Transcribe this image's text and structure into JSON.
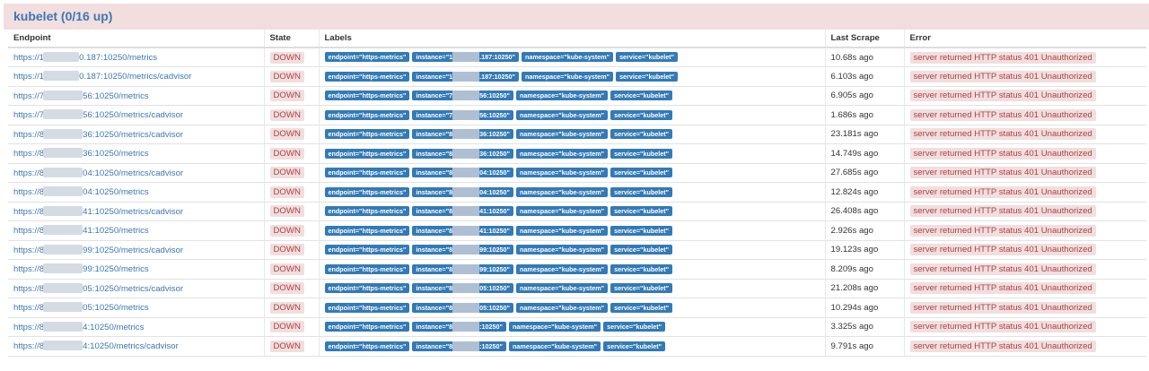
{
  "header": {
    "title": "kubelet (0/16 up)"
  },
  "columns": {
    "endpoint": "Endpoint",
    "state": "State",
    "labels": "Labels",
    "last_scrape": "Last Scrape",
    "error": "Error"
  },
  "colors": {
    "link": "#3b77b5",
    "header_bg": "#f2dede",
    "label_bg": "#337ab7",
    "error_text": "#a94442",
    "error_bg": "#f2dede"
  },
  "rows": [
    {
      "ep_prefix": "https://1",
      "ep_suffix": "0.187:10250/metrics",
      "state": "DOWN",
      "labels": [
        "endpoint=\"https-metrics\"",
        "instance=\"1",
        ".187:10250\"",
        "namespace=\"kube-system\"",
        "service=\"kubelet\""
      ],
      "last_scrape": "10.68s ago",
      "error": "server returned HTTP status 401 Unauthorized"
    },
    {
      "ep_prefix": "https://1",
      "ep_suffix": "0.187:10250/metrics/cadvisor",
      "state": "DOWN",
      "labels": [
        "endpoint=\"https-metrics\"",
        "instance=\"1",
        ".187:10250\"",
        "namespace=\"kube-system\"",
        "service=\"kubelet\""
      ],
      "last_scrape": "6.103s ago",
      "error": "server returned HTTP status 401 Unauthorized"
    },
    {
      "ep_prefix": "https://7",
      "ep_suffix": "56:10250/metrics",
      "state": "DOWN",
      "labels": [
        "endpoint=\"https-metrics\"",
        "instance=\"7",
        "56:10250\"",
        "namespace=\"kube-system\"",
        "service=\"kubelet\""
      ],
      "last_scrape": "6.905s ago",
      "error": "server returned HTTP status 401 Unauthorized"
    },
    {
      "ep_prefix": "https://7",
      "ep_suffix": "56:10250/metrics/cadvisor",
      "state": "DOWN",
      "labels": [
        "endpoint=\"https-metrics\"",
        "instance=\"7",
        "56:10250\"",
        "namespace=\"kube-system\"",
        "service=\"kubelet\""
      ],
      "last_scrape": "1.686s ago",
      "error": "server returned HTTP status 401 Unauthorized"
    },
    {
      "ep_prefix": "https://8",
      "ep_suffix": "36:10250/metrics/cadvisor",
      "state": "DOWN",
      "labels": [
        "endpoint=\"https-metrics\"",
        "instance=\"8",
        "36:10250\"",
        "namespace=\"kube-system\"",
        "service=\"kubelet\""
      ],
      "last_scrape": "23.181s ago",
      "error": "server returned HTTP status 401 Unauthorized"
    },
    {
      "ep_prefix": "https://8",
      "ep_suffix": "36:10250/metrics",
      "state": "DOWN",
      "labels": [
        "endpoint=\"https-metrics\"",
        "instance=\"8",
        "36:10250\"",
        "namespace=\"kube-system\"",
        "service=\"kubelet\""
      ],
      "last_scrape": "14.749s ago",
      "error": "server returned HTTP status 401 Unauthorized"
    },
    {
      "ep_prefix": "https://8",
      "ep_suffix": "04:10250/metrics/cadvisor",
      "state": "DOWN",
      "labels": [
        "endpoint=\"https-metrics\"",
        "instance=\"8",
        "04:10250\"",
        "namespace=\"kube-system\"",
        "service=\"kubelet\""
      ],
      "last_scrape": "27.685s ago",
      "error": "server returned HTTP status 401 Unauthorized"
    },
    {
      "ep_prefix": "https://8",
      "ep_suffix": "04:10250/metrics",
      "state": "DOWN",
      "labels": [
        "endpoint=\"https-metrics\"",
        "instance=\"8",
        "04:10250\"",
        "namespace=\"kube-system\"",
        "service=\"kubelet\""
      ],
      "last_scrape": "12.824s ago",
      "error": "server returned HTTP status 401 Unauthorized"
    },
    {
      "ep_prefix": "https://8",
      "ep_suffix": "41:10250/metrics/cadvisor",
      "state": "DOWN",
      "labels": [
        "endpoint=\"https-metrics\"",
        "instance=\"8",
        "41:10250\"",
        "namespace=\"kube-system\"",
        "service=\"kubelet\""
      ],
      "last_scrape": "26.408s ago",
      "error": "server returned HTTP status 401 Unauthorized"
    },
    {
      "ep_prefix": "https://8",
      "ep_suffix": "41:10250/metrics",
      "state": "DOWN",
      "labels": [
        "endpoint=\"https-metrics\"",
        "instance=\"8",
        "41:10250\"",
        "namespace=\"kube-system\"",
        "service=\"kubelet\""
      ],
      "last_scrape": "2.926s ago",
      "error": "server returned HTTP status 401 Unauthorized"
    },
    {
      "ep_prefix": "https://8",
      "ep_suffix": "99:10250/metrics/cadvisor",
      "state": "DOWN",
      "labels": [
        "endpoint=\"https-metrics\"",
        "instance=\"8",
        "99:10250\"",
        "namespace=\"kube-system\"",
        "service=\"kubelet\""
      ],
      "last_scrape": "19.123s ago",
      "error": "server returned HTTP status 401 Unauthorized"
    },
    {
      "ep_prefix": "https://8",
      "ep_suffix": "99:10250/metrics",
      "state": "DOWN",
      "labels": [
        "endpoint=\"https-metrics\"",
        "instance=\"8",
        "99:10250\"",
        "namespace=\"kube-system\"",
        "service=\"kubelet\""
      ],
      "last_scrape": "8.209s ago",
      "error": "server returned HTTP status 401 Unauthorized"
    },
    {
      "ep_prefix": "https://8",
      "ep_suffix": "05:10250/metrics/cadvisor",
      "state": "DOWN",
      "labels": [
        "endpoint=\"https-metrics\"",
        "instance=\"8",
        "05:10250\"",
        "namespace=\"kube-system\"",
        "service=\"kubelet\""
      ],
      "last_scrape": "21.208s ago",
      "error": "server returned HTTP status 401 Unauthorized"
    },
    {
      "ep_prefix": "https://8",
      "ep_suffix": "05:10250/metrics",
      "state": "DOWN",
      "labels": [
        "endpoint=\"https-metrics\"",
        "instance=\"8",
        "05:10250\"",
        "namespace=\"kube-system\"",
        "service=\"kubelet\""
      ],
      "last_scrape": "10.294s ago",
      "error": "server returned HTTP status 401 Unauthorized"
    },
    {
      "ep_prefix": "https://8",
      "ep_suffix": "4:10250/metrics",
      "state": "DOWN",
      "labels": [
        "endpoint=\"https-metrics\"",
        "instance=\"8",
        ":10250\"",
        "namespace=\"kube-system\"",
        "service=\"kubelet\""
      ],
      "last_scrape": "3.325s ago",
      "error": "server returned HTTP status 401 Unauthorized"
    },
    {
      "ep_prefix": "https://8",
      "ep_suffix": "4:10250/metrics/cadvisor",
      "state": "DOWN",
      "labels": [
        "endpoint=\"https-metrics\"",
        "instance=\"8",
        ":10250\"",
        "namespace=\"kube-system\"",
        "service=\"kubelet\""
      ],
      "last_scrape": "9.791s ago",
      "error": "server returned HTTP status 401 Unauthorized"
    }
  ]
}
